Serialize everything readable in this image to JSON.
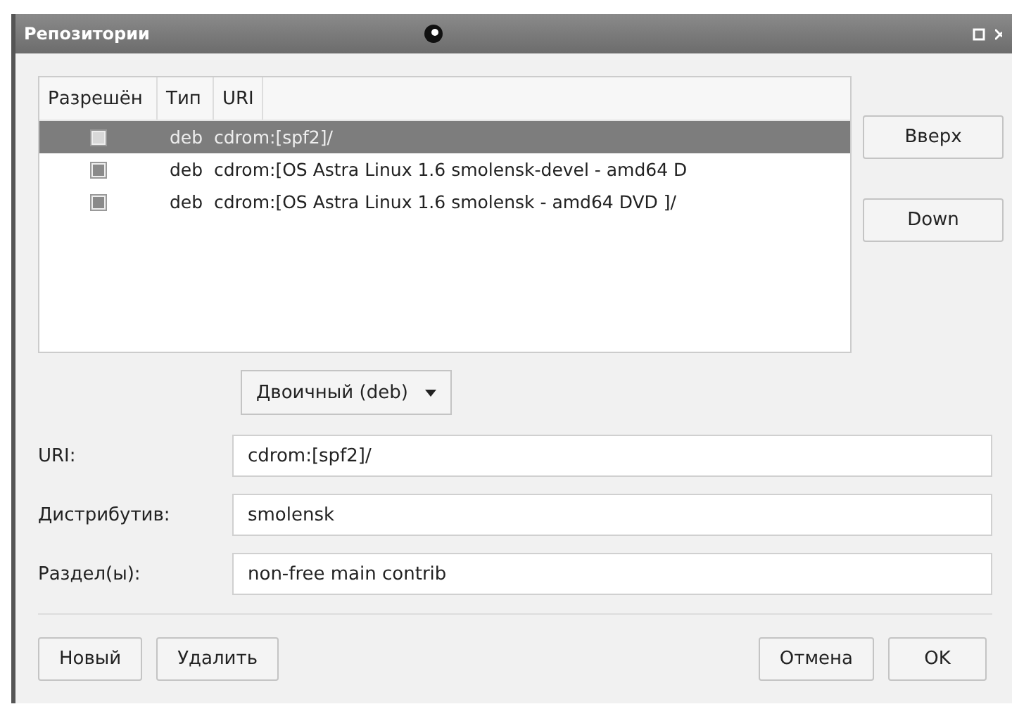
{
  "window": {
    "title": "Репозитории"
  },
  "table": {
    "columns": [
      "Разрешён",
      "Тип",
      "URI"
    ],
    "rows": [
      {
        "enabled": false,
        "type": "deb",
        "uri": "cdrom:[spf2]/",
        "selected": true
      },
      {
        "enabled": true,
        "type": "deb",
        "uri": "cdrom:[OS Astra Linux 1.6 smolensk-devel - amd64 D",
        "selected": false
      },
      {
        "enabled": true,
        "type": "deb",
        "uri": "cdrom:[OS Astra Linux 1.6 smolensk - amd64 DVD ]/",
        "selected": false
      }
    ]
  },
  "side_buttons": [
    "Вверх",
    "Down"
  ],
  "type_select": {
    "value": "Двоичный (deb)"
  },
  "fields": [
    {
      "label": "URI:",
      "value": "cdrom:[spf2]/"
    },
    {
      "label": "Дистрибутив:",
      "value": "smolensk"
    },
    {
      "label": "Раздел(ы):",
      "value": "non-free main contrib"
    }
  ],
  "left_buttons": [
    "Новый",
    "Удалить"
  ],
  "right_buttons": [
    "Отмена",
    "OK"
  ]
}
